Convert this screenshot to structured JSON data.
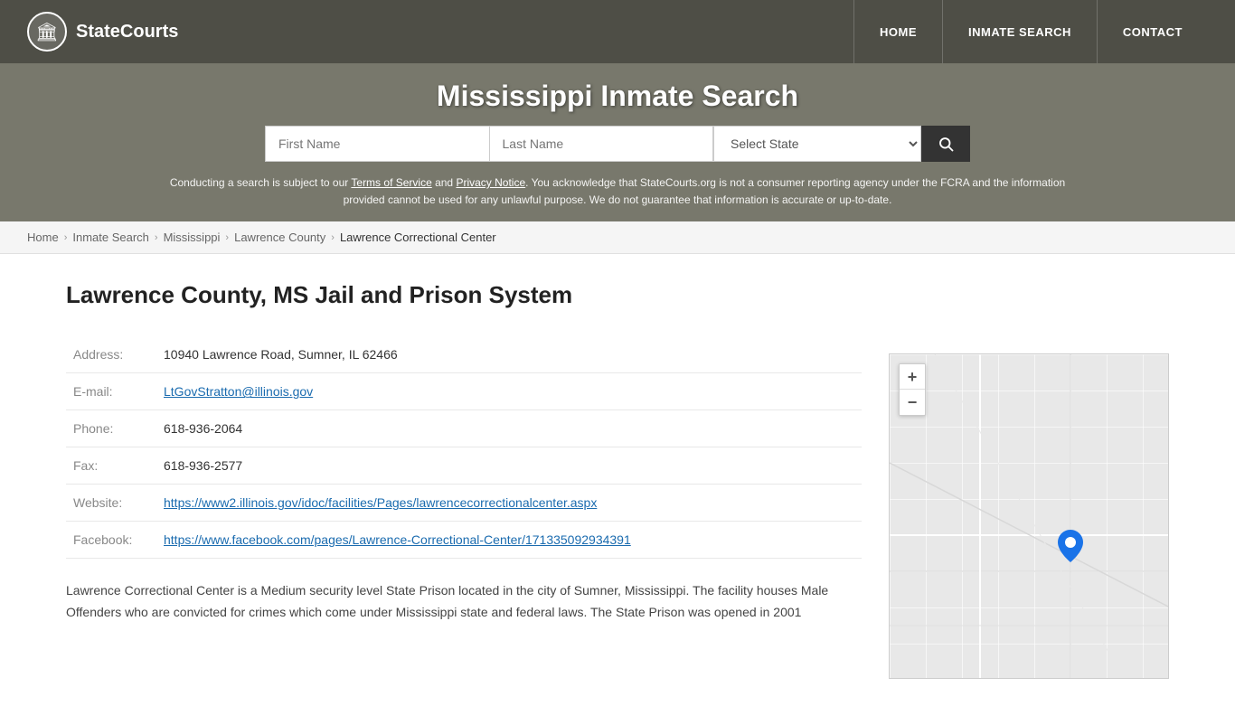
{
  "site": {
    "logo_icon": "🏛",
    "logo_text": "StateCourts"
  },
  "nav": {
    "home_label": "HOME",
    "inmate_search_label": "INMATE SEARCH",
    "contact_label": "CONTACT"
  },
  "hero": {
    "title": "Mississippi Inmate Search",
    "search": {
      "first_name_placeholder": "First Name",
      "last_name_placeholder": "Last Name",
      "state_placeholder": "Select State",
      "search_icon": "🔍"
    },
    "disclaimer": "Conducting a search is subject to our Terms of Service and Privacy Notice. You acknowledge that StateCourts.org is not a consumer reporting agency under the FCRA and the information provided cannot be used for any unlawful purpose. We do not guarantee that information is accurate or up-to-date."
  },
  "breadcrumb": {
    "home": "Home",
    "inmate_search": "Inmate Search",
    "state": "Mississippi",
    "county": "Lawrence County",
    "current": "Lawrence Correctional Center"
  },
  "facility": {
    "heading": "Lawrence County, MS Jail and Prison System",
    "address_label": "Address:",
    "address_value": "10940 Lawrence Road, Sumner, IL 62466",
    "email_label": "E-mail:",
    "email_value": "LtGovStratton@illinois.gov",
    "phone_label": "Phone:",
    "phone_value": "618-936-2064",
    "fax_label": "Fax:",
    "fax_value": "618-936-2577",
    "website_label": "Website:",
    "website_value": "https://www2.illinois.gov/idoc/facilities/Pages/lawrencecorrectionalcenter.aspx",
    "facebook_label": "Facebook:",
    "facebook_value": "https://www.facebook.com/pages/Lawrence-Correctional-Center/171335092934391",
    "description": "Lawrence Correctional Center is a Medium security level State Prison located in the city of Sumner, Mississippi. The facility houses Male Offenders who are convicted for crimes which come under Mississippi state and federal laws. The State Prison was opened in 2001"
  },
  "map": {
    "zoom_in": "+",
    "zoom_out": "−",
    "pin": "📍"
  }
}
